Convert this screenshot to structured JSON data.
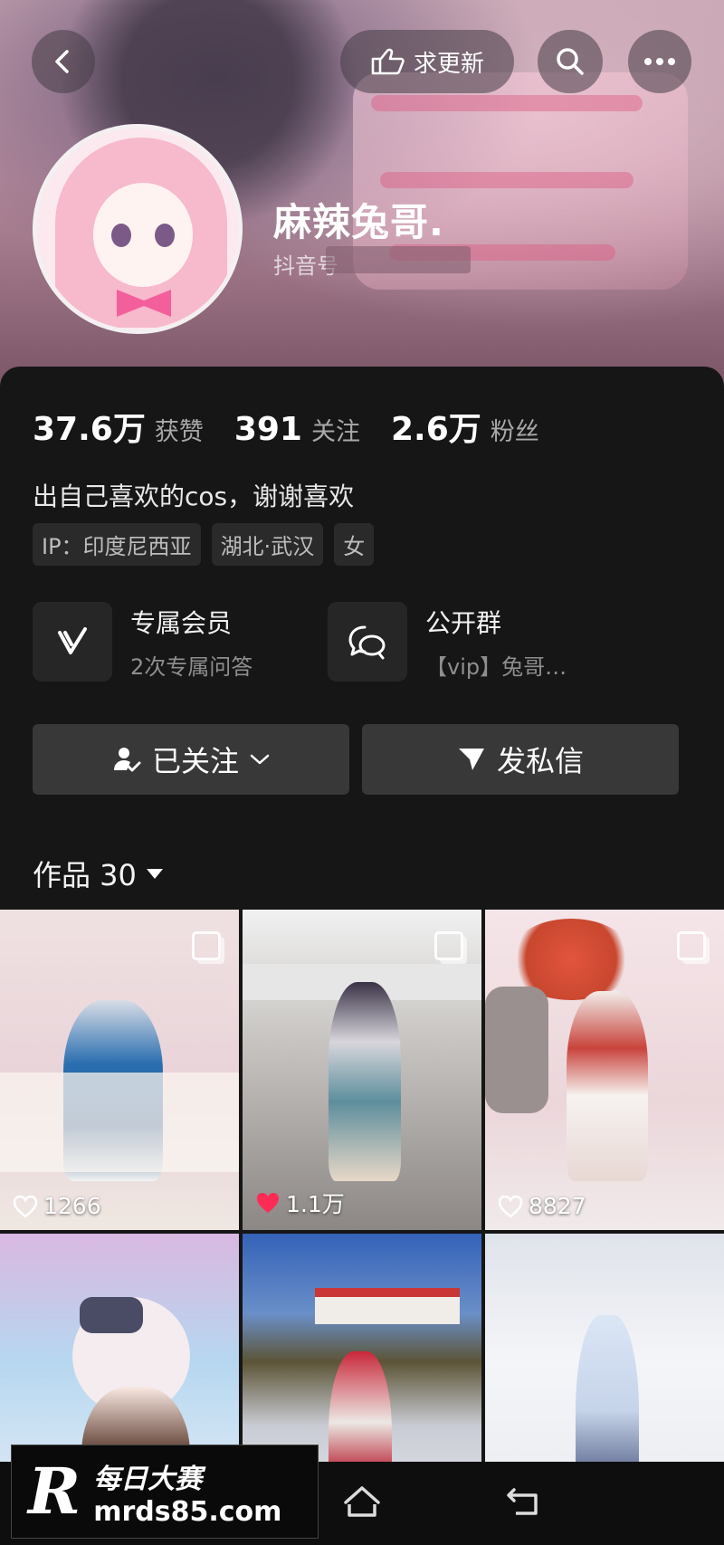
{
  "header": {
    "update_request_label": "求更新",
    "nickname": "麻辣兔哥.",
    "douyin_id_prefix": "抖音号"
  },
  "stats": [
    {
      "value": "37.6万",
      "label": "获赞"
    },
    {
      "value": "391",
      "label": "关注"
    },
    {
      "value": "2.6万",
      "label": "粉丝"
    }
  ],
  "bio": "出自己喜欢的cos，谢谢喜欢",
  "tags": [
    "IP：印度尼西亚",
    "湖北·武汉",
    "女"
  ],
  "features": [
    {
      "title": "专属会员",
      "subtitle": "2次专属问答",
      "icon": "v-badge-icon"
    },
    {
      "title": "公开群",
      "subtitle": "【vip】兔哥…",
      "icon": "chat-group-icon"
    }
  ],
  "actions": {
    "follow_label": "已关注",
    "message_label": "发私信"
  },
  "works": {
    "label": "作品 30"
  },
  "grid": [
    {
      "likes": "1266",
      "liked": false,
      "multi": true
    },
    {
      "likes": "1.1万",
      "liked": true,
      "multi": true
    },
    {
      "likes": "8827",
      "liked": false,
      "multi": true
    },
    {
      "likes": "",
      "liked": false,
      "multi": false
    },
    {
      "likes": "",
      "liked": false,
      "multi": false
    },
    {
      "likes": "",
      "liked": false,
      "multi": false
    }
  ],
  "watermark": {
    "logo": "R",
    "line1": "每日大赛",
    "line2": "mrds85.com"
  },
  "colors": {
    "background": "#161616",
    "button": "#383838",
    "liked_heart": "#fe2c55",
    "muted_text": "#a9a9a9"
  }
}
